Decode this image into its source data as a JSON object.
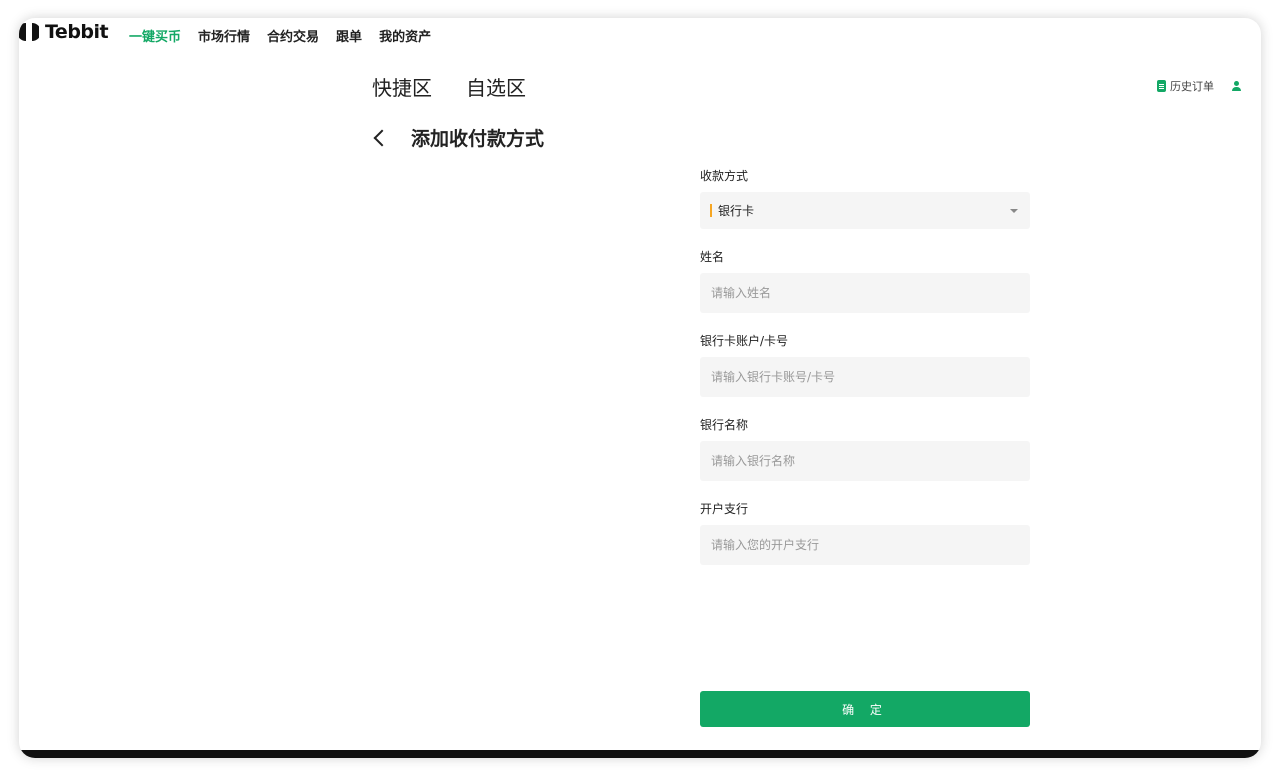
{
  "brand": {
    "name": "Tebbit"
  },
  "nav": {
    "items": [
      {
        "label": "一键买币",
        "active": true
      },
      {
        "label": "市场行情"
      },
      {
        "label": "合约交易"
      },
      {
        "label": "跟单"
      },
      {
        "label": "我的资产"
      }
    ]
  },
  "tabs": [
    {
      "label": "快捷区"
    },
    {
      "label": "自选区"
    }
  ],
  "right_links": {
    "history_label": "历史订单"
  },
  "page": {
    "title": "添加收付款方式"
  },
  "form": {
    "method": {
      "label": "收款方式",
      "value": "银行卡"
    },
    "name": {
      "label": "姓名",
      "placeholder": "请输入姓名",
      "value": ""
    },
    "account": {
      "label": "银行卡账户/卡号",
      "placeholder": "请输入银行卡账号/卡号",
      "value": ""
    },
    "bank_name": {
      "label": "银行名称",
      "placeholder": "请输入银行名称",
      "value": ""
    },
    "branch": {
      "label": "开户支行",
      "placeholder": "请输入您的开户支行",
      "value": ""
    },
    "confirm_label": "确 定"
  },
  "colors": {
    "accent": "#13a865",
    "select_marker": "#f6a623"
  }
}
